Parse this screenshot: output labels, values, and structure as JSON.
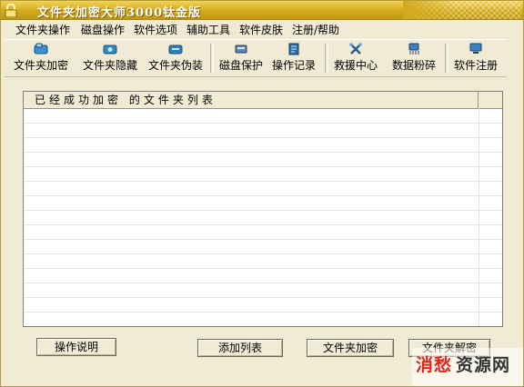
{
  "window": {
    "title": "文件夹加密大师3000钛金版"
  },
  "menu": [
    "文件夹操作",
    "磁盘操作",
    "软件选项",
    "辅助工具",
    "软件皮肤",
    "注册/帮助"
  ],
  "toolbar": {
    "folder_encrypt": "文件夹加密",
    "folder_hide": "文件夹隐藏",
    "folder_disguise": "文件夹伪装",
    "disk_protect": "磁盘保护",
    "operation_log": "操作记录",
    "rescue_center": "救援中心",
    "data_shred": "数据粉碎",
    "software_register": "软件注册"
  },
  "list": {
    "column_header": "已经成功加密 的文件夹列表",
    "rows": 15
  },
  "buttons": {
    "instructions": "操作说明",
    "add_list": "添加列表",
    "folder_encrypt": "文件夹加密",
    "folder_decrypt": "文件夹解密"
  },
  "watermark": {
    "part1": "消愁",
    "part2": "资源网"
  },
  "colors": {
    "titlebar": "#d2a91a",
    "window_bg": "#f1ead4",
    "list_bg": "#ffffff",
    "watermark_red": "#e0241f"
  }
}
